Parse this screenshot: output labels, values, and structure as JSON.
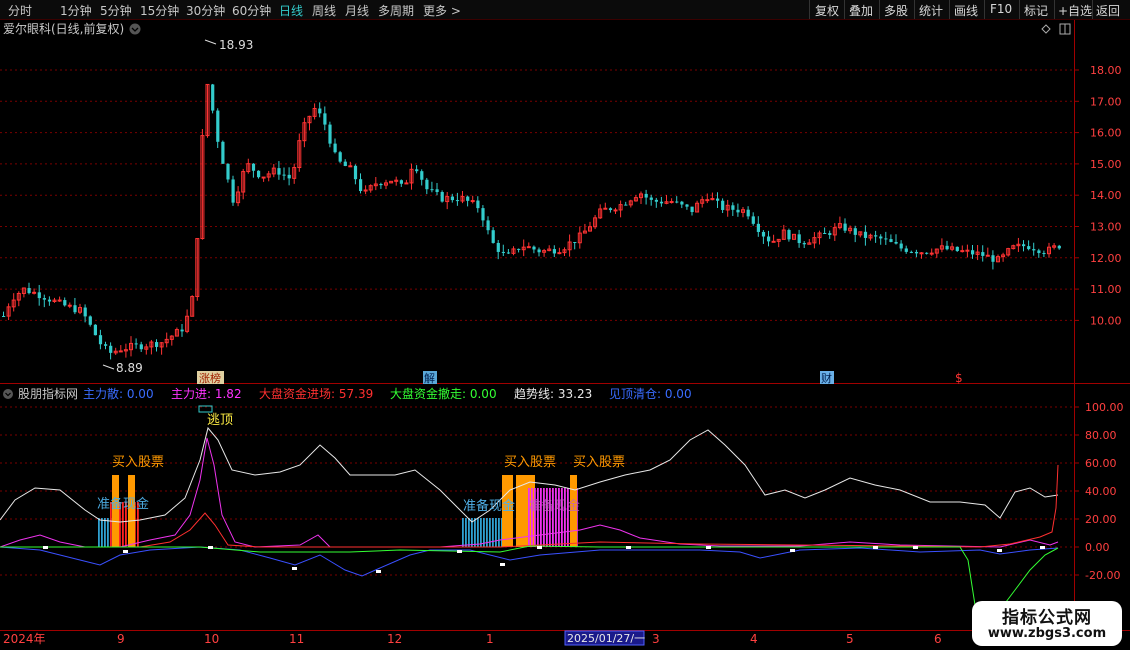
{
  "toolbar": {
    "periods": [
      "分时",
      "1分钟",
      "5分钟",
      "15分钟",
      "30分钟",
      "60分钟",
      "日线",
      "周线",
      "月线",
      "多周期",
      "更多 >"
    ],
    "active_period": "日线",
    "right_buttons": [
      "复权",
      "叠加",
      "多股",
      "统计",
      "画线",
      "F10",
      "标记",
      "+自选",
      "返回"
    ]
  },
  "main_chart": {
    "title": "爱尔眼科(日线,前复权)",
    "y_ticks": [
      "18.00",
      "17.00",
      "16.00",
      "15.00",
      "14.00",
      "13.00",
      "12.00",
      "11.00",
      "10.00"
    ],
    "high_label": "18.93",
    "low_label": "8.89",
    "badges": [
      "涨榜",
      "解",
      "财",
      "$"
    ]
  },
  "indicator": {
    "name": "股朋指标网",
    "items": [
      {
        "label": "主力散:",
        "value": "0.00",
        "color": "#3a6cff"
      },
      {
        "label": "主力进:",
        "value": "1.82",
        "color": "#ff33ff"
      },
      {
        "label": "大盘资金进场:",
        "value": "57.39",
        "color": "#ff3030"
      },
      {
        "label": "大盘资金撤走:",
        "value": "0.00",
        "color": "#33ff33"
      },
      {
        "label": "趋势线:",
        "value": "33.23",
        "color": "#e8e8e8"
      },
      {
        "label": "见顶清仓:",
        "value": "0.00",
        "color": "#3a6cff"
      }
    ],
    "y_ticks": [
      "100.00",
      "80.00",
      "60.00",
      "40.00",
      "20.00",
      "0.00",
      "-20.00"
    ],
    "annotations": {
      "top": "逃顶",
      "buy": "买入股票",
      "prepare": "准备现金"
    }
  },
  "x_axis": {
    "labels": [
      "2024年",
      "9",
      "10",
      "11",
      "12",
      "1",
      "3",
      "4",
      "5",
      "6"
    ],
    "cursor_date": "2025/01/27/一"
  },
  "watermark": {
    "line1": "指标公式网",
    "line2": "www.zbgs3.com"
  },
  "colors": {
    "up": "#ff3333",
    "down": "#33cccc",
    "grid": "#7a0000",
    "axis_text": "#ff4040"
  }
}
